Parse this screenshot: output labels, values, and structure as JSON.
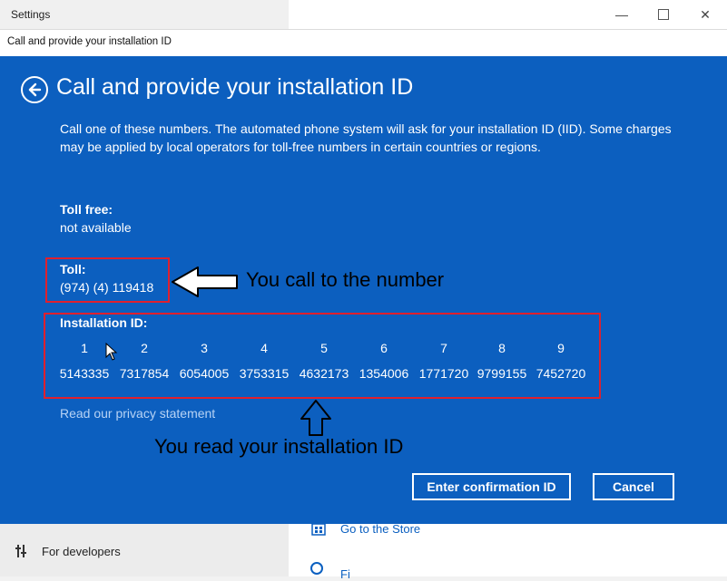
{
  "window": {
    "app_title": "Settings",
    "dialog_caption": "Call and provide your installation ID",
    "minimize_glyph": "—",
    "close_glyph": "✕"
  },
  "dialog": {
    "title": "Call and provide your installation ID",
    "description": "Call one of these numbers. The automated phone system will ask for your installation ID (IID). Some charges may be applied by local operators for toll-free numbers in certain countries or regions.",
    "toll_free_label": "Toll free:",
    "toll_free_value": "not available",
    "toll_label": "Toll:",
    "toll_value": "(974) (4) 119418",
    "installation_id_label": "Installation ID:",
    "installation_id_indices": [
      "1",
      "2",
      "3",
      "4",
      "5",
      "6",
      "7",
      "8",
      "9"
    ],
    "installation_id_groups": [
      "5143335",
      "7317854",
      "6054005",
      "3753315",
      "4632173",
      "1354006",
      "1771720",
      "9799155",
      "7452720"
    ],
    "privacy_link": "Read our privacy statement",
    "enter_confirmation_button": "Enter confirmation ID",
    "cancel_button": "Cancel"
  },
  "background": {
    "for_developers": "For developers",
    "go_to_store": "Go to the Store",
    "bottom_link_partial": "Fi"
  },
  "annotations": {
    "call_text": "You call to the number",
    "read_text": "You read your installation ID"
  },
  "colors": {
    "dialog_blue": "#0c5fbf",
    "link_blue": "#0a5fc0",
    "annotation_red": "#e0202e"
  },
  "icons": {
    "back": "back-arrow-icon",
    "store": "store-icon",
    "developers": "developer-tools-icon"
  }
}
